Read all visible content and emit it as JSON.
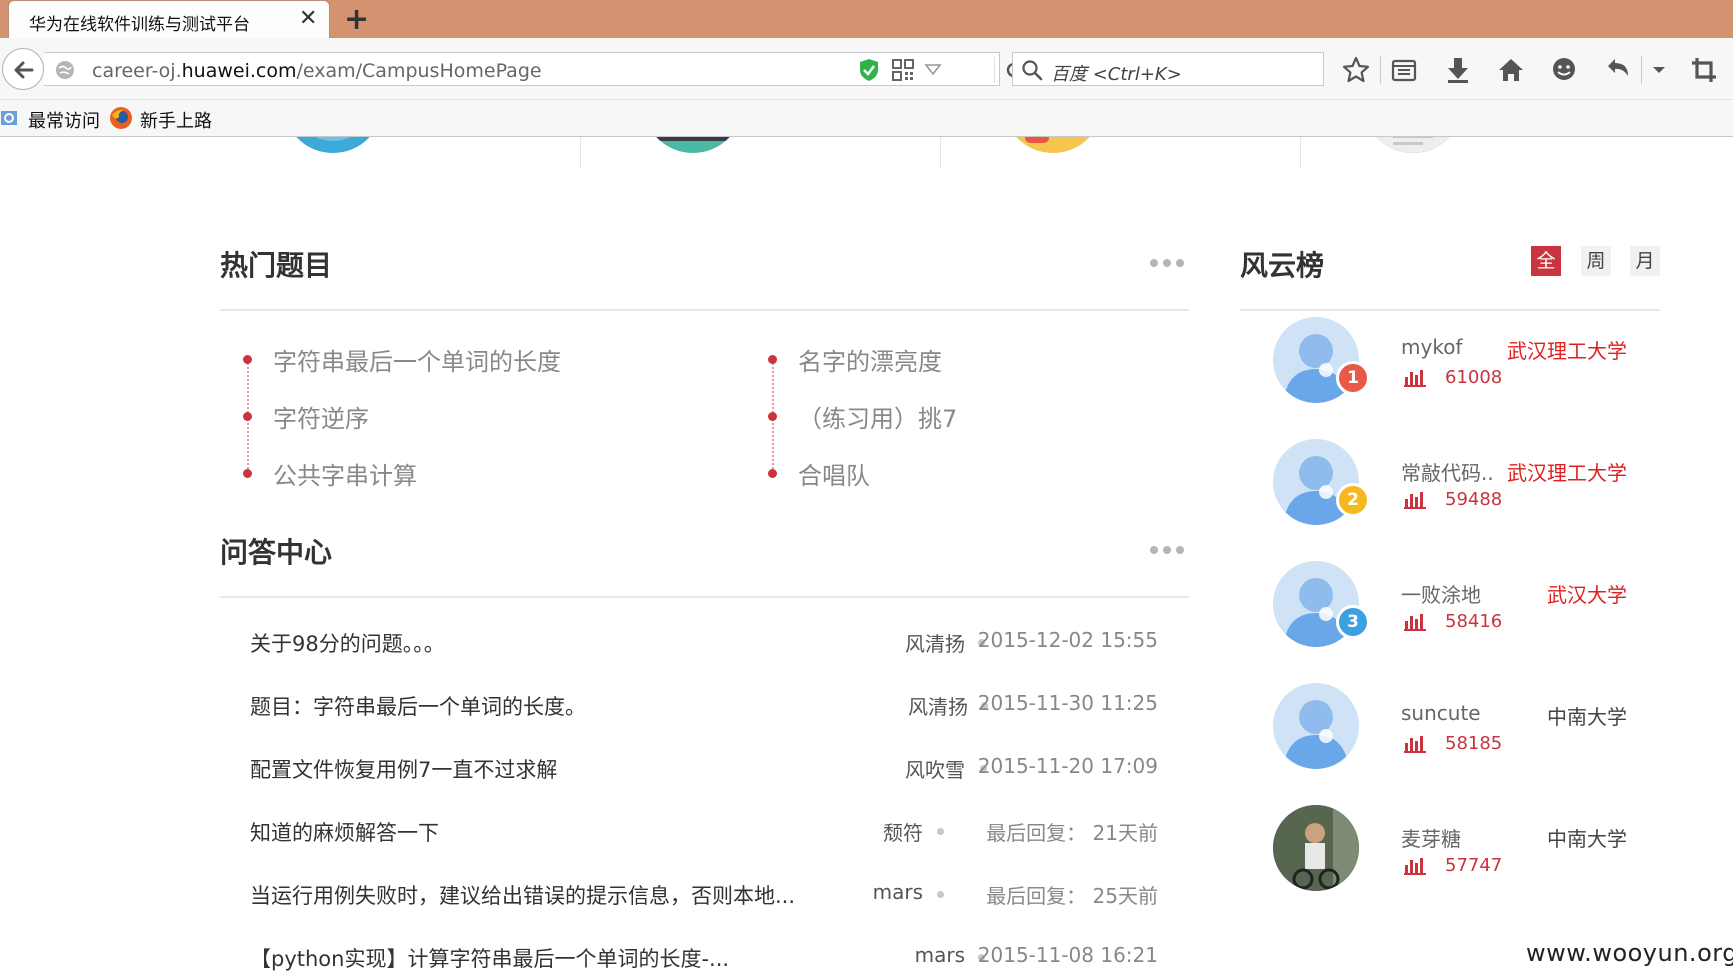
{
  "browser": {
    "tab_title": "华为在线软件训练与测试平台",
    "tab_close": "✕",
    "new_tab": "+",
    "url_prefix": "career-oj.",
    "url_domain": "huawei.com",
    "url_path": "/exam/CampusHomePage",
    "search_placeholder": "百度 <Ctrl+K>",
    "bookmarks": [
      "最常访问",
      "新手上路"
    ]
  },
  "hot_problems": {
    "title": "热门题目",
    "left": [
      "字符串最后一个单词的长度",
      "字符逆序",
      "公共字串计算"
    ],
    "right": [
      "名字的漂亮度",
      "（练习用）挑7",
      "合唱队"
    ]
  },
  "qa_center": {
    "title": "问答中心",
    "rows": [
      {
        "title": "关于98分的问题。。。",
        "author": "风清扬",
        "time": "2015-12-02 15:55"
      },
      {
        "title": "题目：字符串最后一个单词的长度。",
        "author": "风清扬",
        "time": "2015-11-30 11:25"
      },
      {
        "title": "配置文件恢复用例7一直不过求解",
        "author": "风吹雪",
        "time": "2015-11-20 17:09"
      },
      {
        "title": "知道的麻烦解答一下",
        "author": "颓符",
        "time": "最后回复： 21天前"
      },
      {
        "title": "当运行用例失败时，建议给出错误的提示信息，否则本地...",
        "author": "mars",
        "time": "最后回复： 25天前"
      },
      {
        "title": "【python实现】计算字符串最后一个单词的长度-...",
        "author": "mars",
        "time": "2015-11-08 16:21"
      }
    ]
  },
  "leaderboard": {
    "title": "风云榜",
    "filters": [
      "全",
      "周",
      "月"
    ],
    "active_filter": "全",
    "users": [
      {
        "name": "mykof",
        "school": "武汉理工大学",
        "score": "61008",
        "rank": "1",
        "medal_color": "#e9594a",
        "school_color": "#e02020"
      },
      {
        "name": "常敲代码..",
        "school": "武汉理工大学",
        "score": "59488",
        "rank": "2",
        "medal_color": "#f5b81f",
        "school_color": "#e02020"
      },
      {
        "name": "一败涂地",
        "school": "武汉大学",
        "score": "58416",
        "rank": "3",
        "medal_color": "#3aa0e0",
        "school_color": "#e02020"
      },
      {
        "name": "suncute",
        "school": "中南大学",
        "score": "58185",
        "rank": "",
        "medal_color": "",
        "school_color": "#444444"
      },
      {
        "name": "麦芽糖",
        "school": "中南大学",
        "score": "57747",
        "rank": "",
        "medal_color": "",
        "school_color": "#444444"
      }
    ]
  },
  "watermark": "www.wooyun.org",
  "colors": {
    "accent": "#c9343e",
    "tab_bar": "#d39270"
  }
}
